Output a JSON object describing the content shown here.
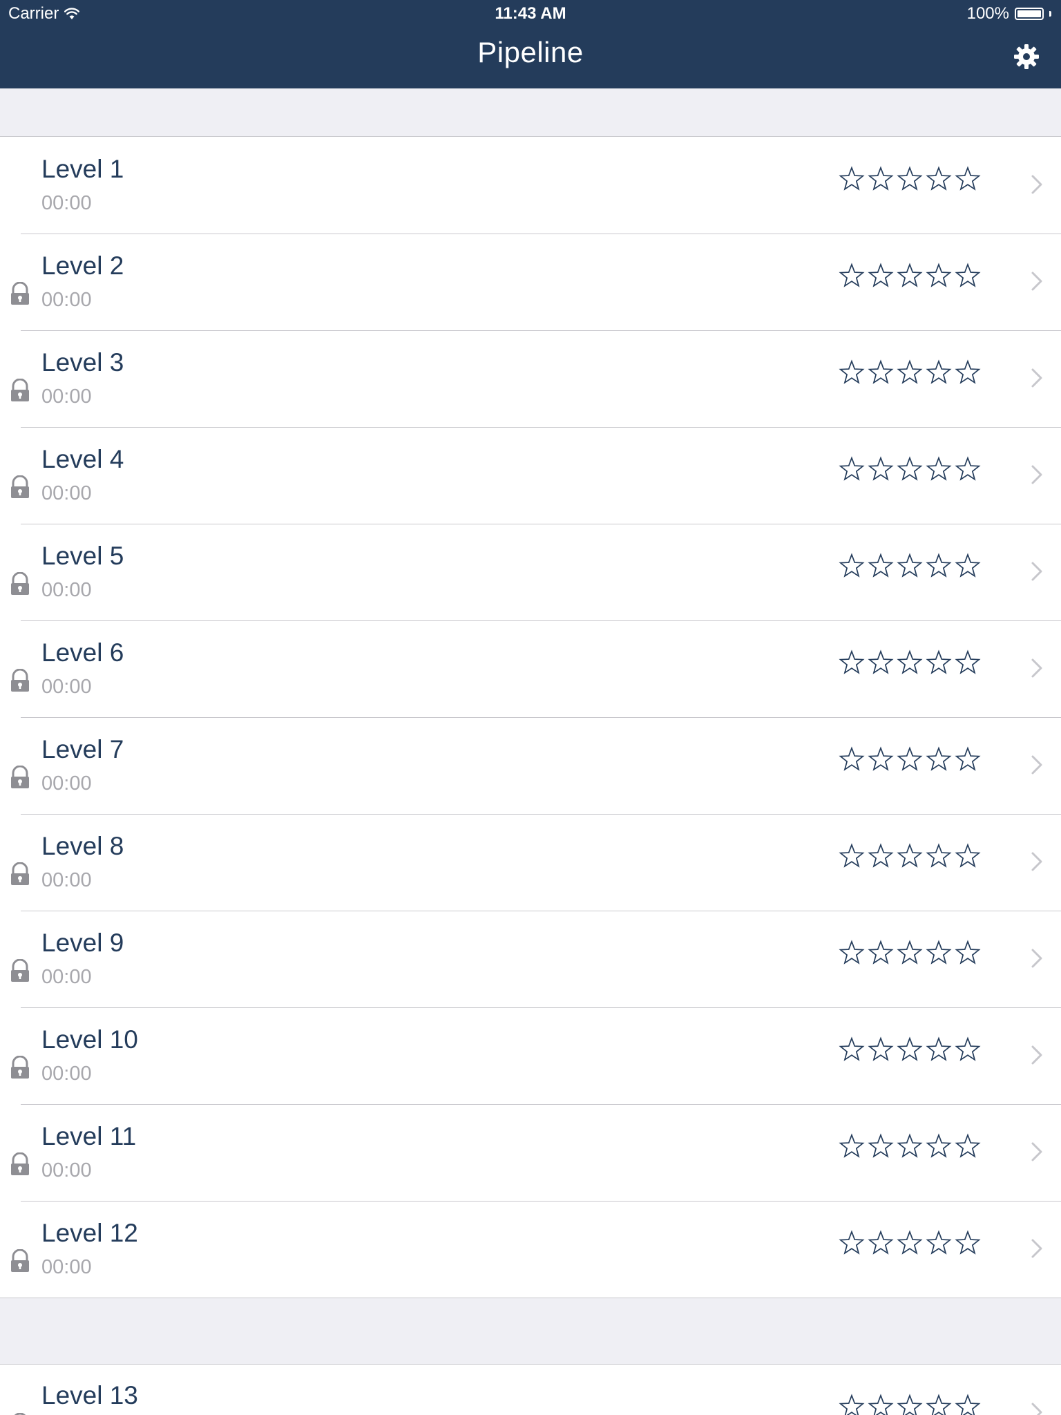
{
  "status_bar": {
    "carrier": "Carrier",
    "time": "11:43 AM",
    "battery": "100%",
    "battery_level": 1.0
  },
  "nav": {
    "title": "Pipeline",
    "settings_icon": "gear-icon"
  },
  "colors": {
    "nav_background": "#243c5b",
    "level_text": "#243c5b",
    "time_text": "#a8a8ad",
    "separator": "#c8c7cc",
    "group_background": "#efeff4"
  },
  "levels": [
    {
      "name": "Level 1",
      "time": "00:00",
      "locked": false,
      "stars": 0
    },
    {
      "name": "Level 2",
      "time": "00:00",
      "locked": true,
      "stars": 0
    },
    {
      "name": "Level 3",
      "time": "00:00",
      "locked": true,
      "stars": 0
    },
    {
      "name": "Level 4",
      "time": "00:00",
      "locked": true,
      "stars": 0
    },
    {
      "name": "Level 5",
      "time": "00:00",
      "locked": true,
      "stars": 0
    },
    {
      "name": "Level 6",
      "time": "00:00",
      "locked": true,
      "stars": 0
    },
    {
      "name": "Level 7",
      "time": "00:00",
      "locked": true,
      "stars": 0
    },
    {
      "name": "Level 8",
      "time": "00:00",
      "locked": true,
      "stars": 0
    },
    {
      "name": "Level 9",
      "time": "00:00",
      "locked": true,
      "stars": 0
    },
    {
      "name": "Level 10",
      "time": "00:00",
      "locked": true,
      "stars": 0
    },
    {
      "name": "Level 11",
      "time": "00:00",
      "locked": true,
      "stars": 0
    },
    {
      "name": "Level 12",
      "time": "00:00",
      "locked": true,
      "stars": 0
    }
  ],
  "levels_group2": [
    {
      "name": "Level 13",
      "locked": true,
      "stars": 0
    }
  ],
  "max_stars": 5
}
